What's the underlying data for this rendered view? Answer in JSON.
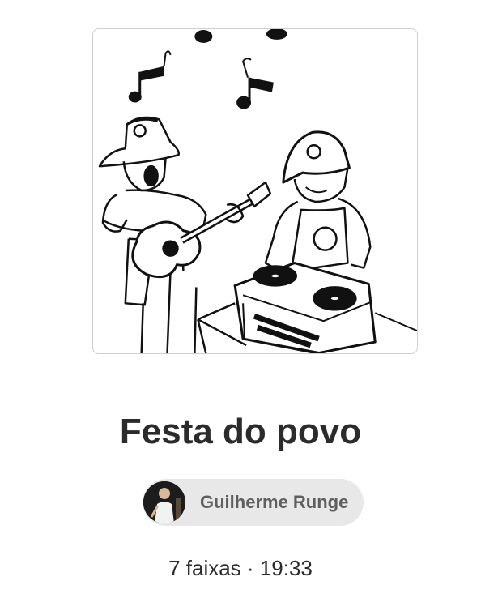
{
  "album": {
    "title": "Festa do povo",
    "artist": "Guilherme Runge",
    "track_count_label": "7 faixas",
    "separator": "·",
    "duration": "19:33"
  },
  "icons": {
    "cover": "cartoon-guitarist-and-dj-cover",
    "avatar": "artist-photo-avatar"
  }
}
